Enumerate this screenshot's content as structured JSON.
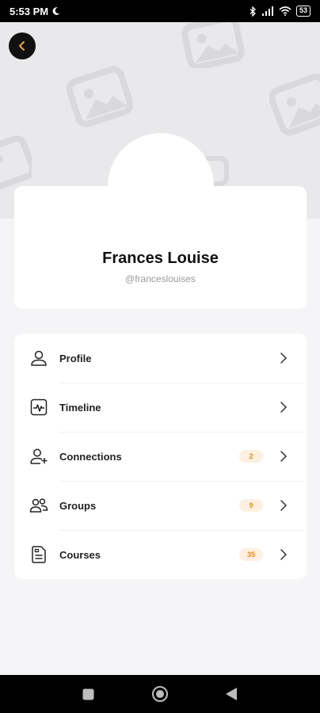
{
  "status_bar": {
    "time": "5:53 PM",
    "battery": "53",
    "icons": [
      "moon-icon",
      "bluetooth-icon",
      "signal-icon",
      "wifi-icon",
      "battery-icon"
    ]
  },
  "header": {
    "back_icon": "chevron-left-icon",
    "accent_color": "#f0a53a"
  },
  "profile": {
    "name": "Frances Louise",
    "handle": "@franceslouises"
  },
  "menu": {
    "items": [
      {
        "label": "Profile",
        "icon": "user-icon",
        "badge": null
      },
      {
        "label": "Timeline",
        "icon": "activity-icon",
        "badge": null
      },
      {
        "label": "Connections",
        "icon": "add-user-icon",
        "badge": "2"
      },
      {
        "label": "Groups",
        "icon": "users-icon",
        "badge": "9"
      },
      {
        "label": "Courses",
        "icon": "document-icon",
        "badge": "35"
      }
    ]
  },
  "nav_bar": {
    "buttons": [
      "recents-button",
      "home-button",
      "back-button"
    ]
  },
  "colors": {
    "badge_bg": "#fdf0e0",
    "badge_text": "#e58a1f"
  }
}
